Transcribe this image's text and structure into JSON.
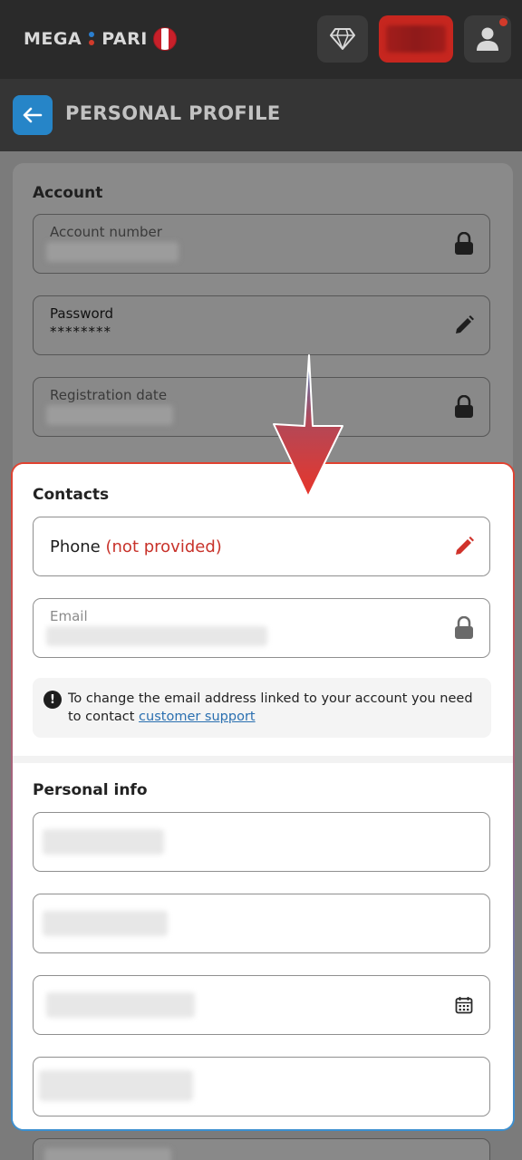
{
  "header": {
    "logo_left": "MEGA",
    "logo_right": "PARI"
  },
  "titlebar": {
    "title": "PERSONAL PROFILE"
  },
  "account": {
    "title": "Account",
    "account_number_label": "Account number",
    "password_label": "Password",
    "password_value": "********",
    "registration_date_label": "Registration date"
  },
  "contacts": {
    "title": "Contacts",
    "phone_label": "Phone",
    "phone_status": "(not provided)",
    "email_label": "Email",
    "notice_text": "To change the email address linked to your account you need to contact",
    "notice_link": "customer support"
  },
  "personal_info": {
    "title": "Personal info"
  },
  "colors": {
    "accent_blue": "#2685c8",
    "accent_red": "#c6261f",
    "warning_red": "#c8322a"
  }
}
